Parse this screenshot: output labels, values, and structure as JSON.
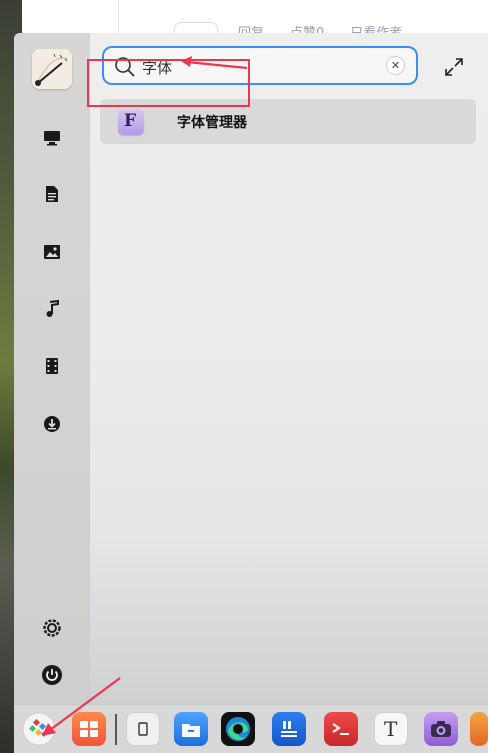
{
  "background": {
    "actions": [
      "回复",
      "点赞0",
      "只看作者"
    ]
  },
  "search": {
    "query": "字体"
  },
  "results": [
    {
      "label": "字体管理器",
      "icon": "font-manager-icon",
      "icon_letter": "F"
    }
  ],
  "colors": {
    "focus_ring": "#3a8ff5",
    "annotation_red": "#e8374f"
  }
}
